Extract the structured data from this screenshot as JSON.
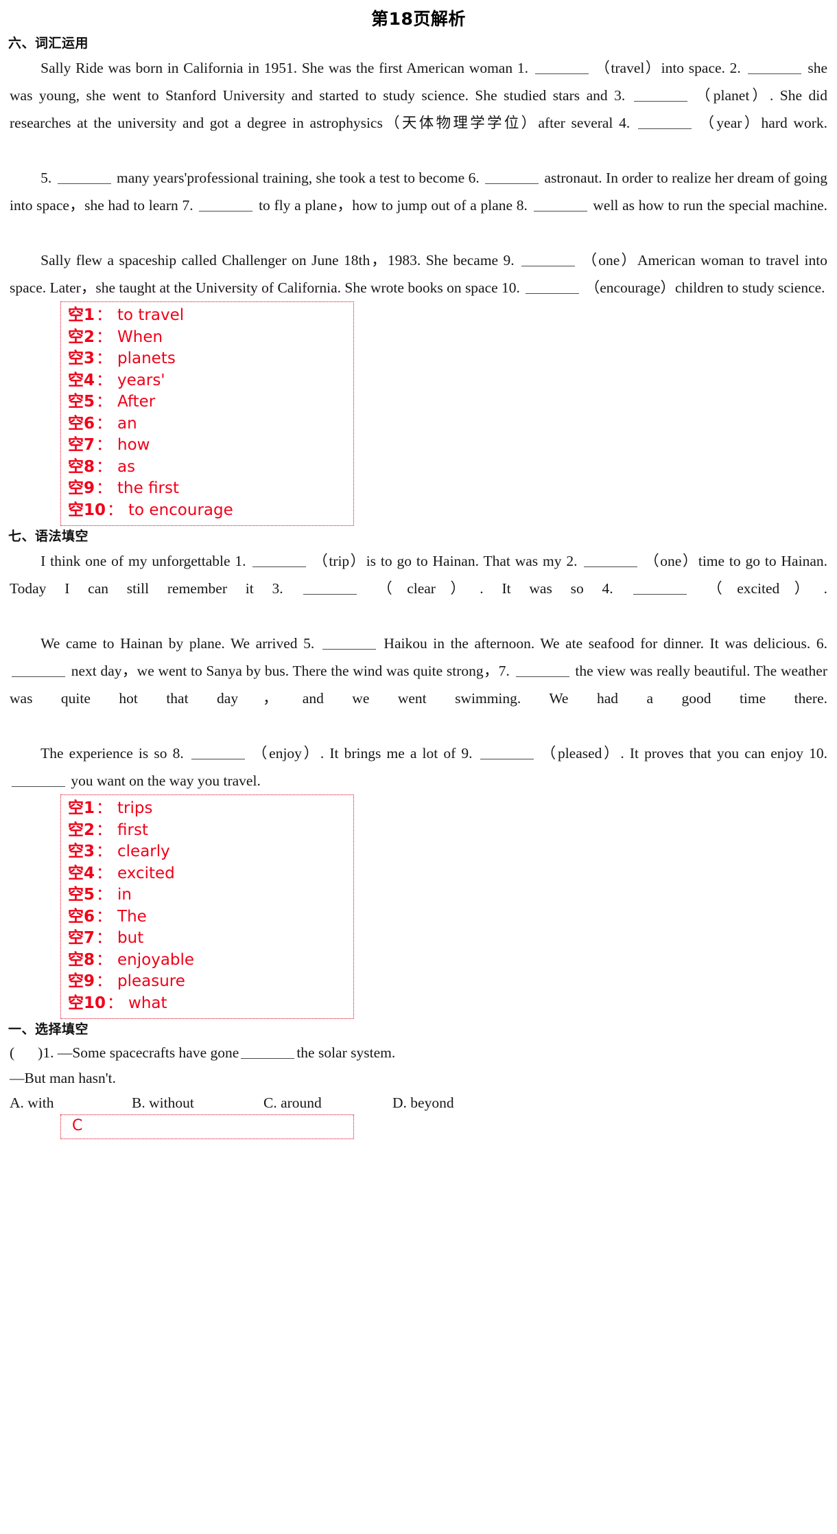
{
  "page": {
    "title": "第18页解析"
  },
  "section_vocab": {
    "heading": "六、词汇运用",
    "paragraphs": [
      {
        "indent": true,
        "parts": [
          {
            "t": "text",
            "v": "Sally Ride was born in California in 1951. She was the first American woman 1."
          },
          {
            "t": "blank"
          },
          {
            "t": "text",
            "v": "（travel）into space. 2."
          },
          {
            "t": "blank"
          },
          {
            "t": "text",
            "v": "she was young, she went to Stanford University and started to study science. She studied stars and 3."
          },
          {
            "t": "blank"
          },
          {
            "t": "text",
            "v": "（planet）. She did researches at the university and got a degree in astrophysics（天体物理学学位）after several 4."
          },
          {
            "t": "blank"
          },
          {
            "t": "text",
            "v": "（year）hard work."
          }
        ]
      },
      {
        "indent": true,
        "parts": [
          {
            "t": "text",
            "v": "5."
          },
          {
            "t": "blank"
          },
          {
            "t": "text",
            "v": "many years'professional training, she took a test to become 6."
          },
          {
            "t": "blank"
          },
          {
            "t": "text",
            "v": "astronaut. In order to realize her dream of going into space，she had to learn 7."
          },
          {
            "t": "blank"
          },
          {
            "t": "text",
            "v": "to fly a plane，how to jump out of a plane 8."
          },
          {
            "t": "blank"
          },
          {
            "t": "text",
            "v": "well as how to run the special machine."
          }
        ]
      },
      {
        "indent": true,
        "parts": [
          {
            "t": "text",
            "v": "Sally flew a spaceship called Challenger on June 18th，1983. She became 9."
          },
          {
            "t": "blank"
          },
          {
            "t": "text",
            "v": "（one）American woman to travel into space. Later，she taught at the University of California. She wrote books on space 10."
          },
          {
            "t": "blank"
          },
          {
            "t": "text",
            "v": "（encourage）children to study science."
          }
        ]
      }
    ],
    "answers": [
      {
        "index": "空1",
        "sep": "：",
        "value": "to travel"
      },
      {
        "index": "空2",
        "sep": "：",
        "value": "When"
      },
      {
        "index": "空3",
        "sep": "：",
        "value": "planets"
      },
      {
        "index": "空4",
        "sep": "：",
        "value": "years'"
      },
      {
        "index": "空5",
        "sep": "：",
        "value": "After"
      },
      {
        "index": "空6",
        "sep": "：",
        "value": "an"
      },
      {
        "index": "空7",
        "sep": "：",
        "value": "how"
      },
      {
        "index": "空8",
        "sep": "：",
        "value": "as"
      },
      {
        "index": "空9",
        "sep": "：",
        "value": "the first"
      },
      {
        "index": "空10",
        "sep": "：",
        "value": "to encourage"
      }
    ]
  },
  "section_grammar": {
    "heading": "七、语法填空",
    "paragraphs": [
      {
        "indent": true,
        "parts": [
          {
            "t": "text",
            "v": "I think one of my unforgettable 1."
          },
          {
            "t": "blank"
          },
          {
            "t": "text",
            "v": "（trip）is to go to Hainan. That was my 2."
          },
          {
            "t": "blank"
          },
          {
            "t": "text",
            "v": "（one）time to go to Hainan. Today I can still remember it 3."
          },
          {
            "t": "blank"
          },
          {
            "t": "text",
            "v": "（clear）. It was so 4."
          },
          {
            "t": "blank"
          },
          {
            "t": "text",
            "v": "（excited）."
          }
        ]
      },
      {
        "indent": true,
        "parts": [
          {
            "t": "text",
            "v": "We came to Hainan by plane. We arrived 5."
          },
          {
            "t": "blank"
          },
          {
            "t": "text",
            "v": "Haikou in the afternoon. We ate seafood for dinner. It was delicious. 6."
          },
          {
            "t": "blank"
          },
          {
            "t": "text",
            "v": "next day，we went to Sanya by bus. There the wind was quite strong，7."
          },
          {
            "t": "blank"
          },
          {
            "t": "text",
            "v": "the view was really beautiful. The weather was quite hot that day，and we went swimming. We had a good time there."
          }
        ]
      },
      {
        "indent": true,
        "parts": [
          {
            "t": "text",
            "v": "The experience is so 8."
          },
          {
            "t": "blank"
          },
          {
            "t": "text",
            "v": "（enjoy）. It brings me a lot of 9."
          },
          {
            "t": "blank"
          },
          {
            "t": "text",
            "v": "（pleased）. It proves that you can enjoy 10."
          },
          {
            "t": "blank"
          },
          {
            "t": "text",
            "v": "you want on the way you travel."
          }
        ]
      }
    ],
    "answers": [
      {
        "index": "空1",
        "sep": "：",
        "value": "trips"
      },
      {
        "index": "空2",
        "sep": "：",
        "value": "first"
      },
      {
        "index": "空3",
        "sep": "：",
        "value": "clearly"
      },
      {
        "index": "空4",
        "sep": "：",
        "value": "excited"
      },
      {
        "index": "空5",
        "sep": "：",
        "value": "in"
      },
      {
        "index": "空6",
        "sep": "：",
        "value": "The"
      },
      {
        "index": "空7",
        "sep": "：",
        "value": "but"
      },
      {
        "index": "空8",
        "sep": "：",
        "value": "enjoyable"
      },
      {
        "index": "空9",
        "sep": "：",
        "value": "pleasure"
      },
      {
        "index": "空10",
        "sep": "：",
        "value": "what"
      }
    ]
  },
  "section_choice": {
    "heading": "一、选择填空",
    "question_number": "1.",
    "question_line1_pre": "—Some spacecrafts have gone",
    "question_line1_post": "the solar system.",
    "question_line2": "—But man hasn't.",
    "options": [
      "A. with",
      "B. without",
      "C. around",
      "D. beyond"
    ],
    "answer": "C"
  },
  "colors": {
    "answer_red": "#f00018",
    "border_red": "#e2001a",
    "text_black": "#161616"
  }
}
